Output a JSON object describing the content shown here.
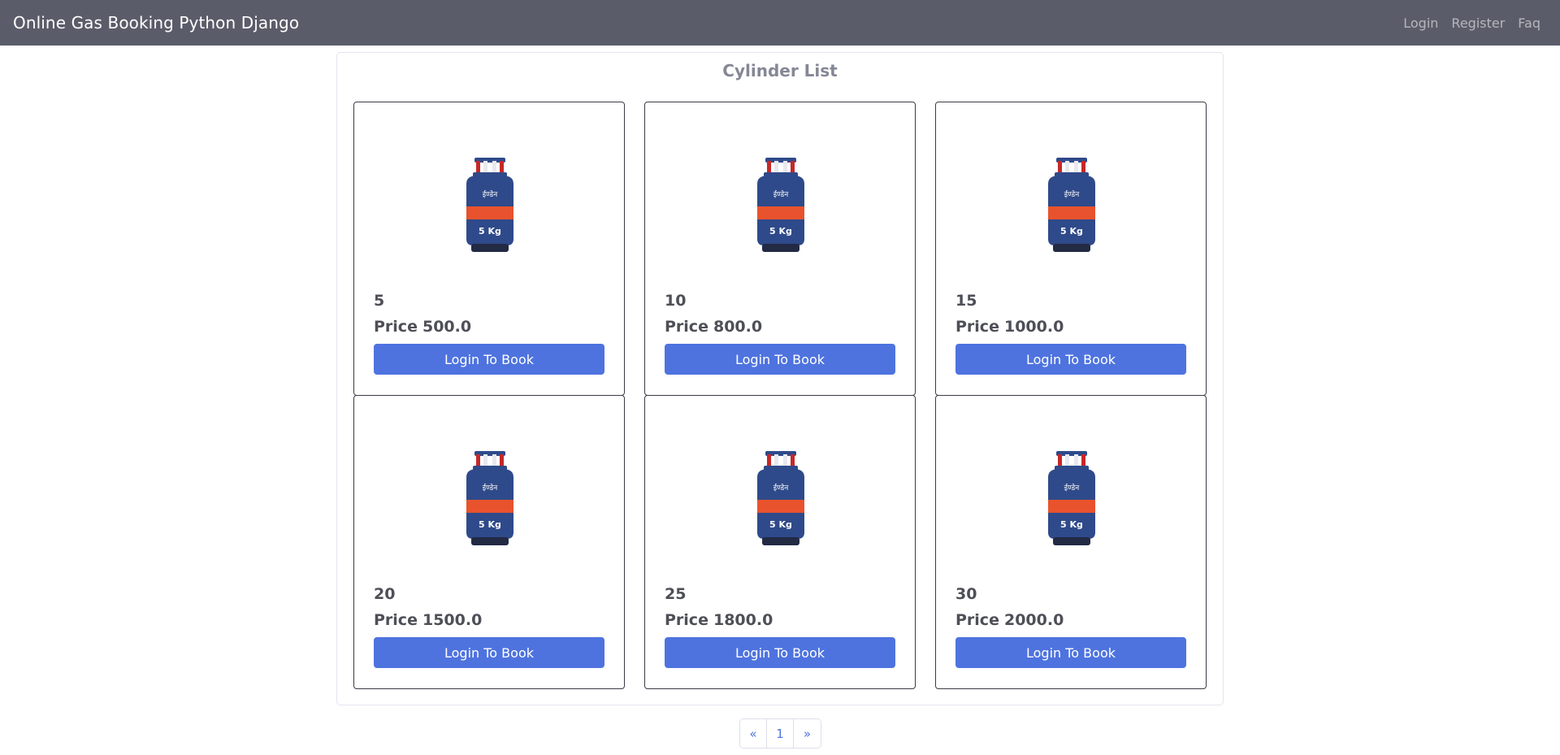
{
  "navbar": {
    "brand": "Online Gas Booking Python Django",
    "links": [
      "Login",
      "Register",
      "Faq"
    ]
  },
  "panel": {
    "title": "Cylinder List"
  },
  "cylinders": [
    {
      "size": "5",
      "price_label": "Price",
      "price": "500.0",
      "button": "Login To Book",
      "image_label": "5 Kg"
    },
    {
      "size": "10",
      "price_label": "Price",
      "price": "800.0",
      "button": "Login To Book",
      "image_label": "5 Kg"
    },
    {
      "size": "15",
      "price_label": "Price",
      "price": "1000.0",
      "button": "Login To Book",
      "image_label": "5 Kg"
    },
    {
      "size": "20",
      "price_label": "Price",
      "price": "1500.0",
      "button": "Login To Book",
      "image_label": "5 Kg"
    },
    {
      "size": "25",
      "price_label": "Price",
      "price": "1800.0",
      "button": "Login To Book",
      "image_label": "5 Kg"
    },
    {
      "size": "30",
      "price_label": "Price",
      "price": "2000.0",
      "button": "Login To Book",
      "image_label": "5 Kg"
    }
  ],
  "pagination": {
    "prev": "«",
    "current": "1",
    "next": "»"
  },
  "colors": {
    "navbar": "#5a5c69",
    "accent": "#4e73df",
    "cylinder_body": "#2f4a8a",
    "cylinder_band": "#e8532d"
  },
  "icons": {
    "cylinder": "gas-cylinder-image"
  }
}
